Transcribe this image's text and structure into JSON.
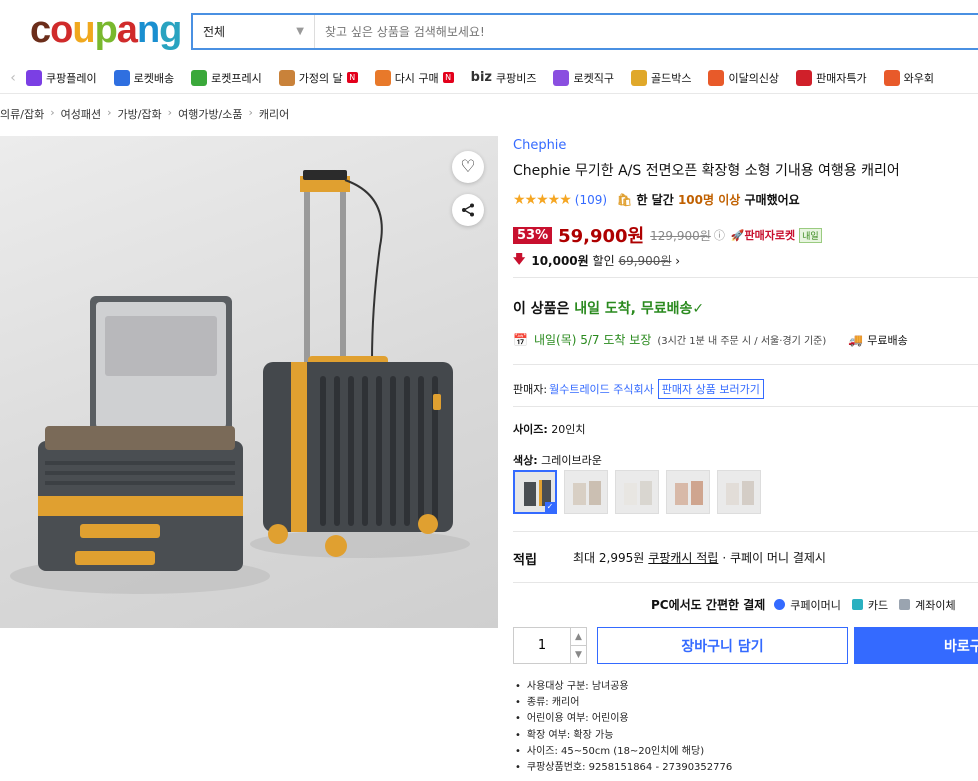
{
  "header": {
    "logo_letters": [
      "c",
      "o",
      "u",
      "p",
      "a",
      "n",
      "g"
    ],
    "logo_colors": [
      "#6b2d1a",
      "#d02b2b",
      "#f0a81e",
      "#79b82e",
      "#d02b2b",
      "#1a8fd0",
      "#29a3c0"
    ],
    "category": "전체",
    "search_placeholder": "찾고 싶은 상품을 검색해보세요!"
  },
  "nav": {
    "items": [
      {
        "label": "쿠팡플레이",
        "icon": "play-icon",
        "color": "#7b3fe4",
        "badge": ""
      },
      {
        "label": "로켓배송",
        "icon": "rocket-icon",
        "color": "#2f6fe0",
        "badge": ""
      },
      {
        "label": "로켓프레시",
        "icon": "rocket-fresh-icon",
        "color": "#3aa83a",
        "badge": ""
      },
      {
        "label": "가정의 달",
        "icon": "bear-icon",
        "color": "#c9823a",
        "badge": "N"
      },
      {
        "label": "다시 구매",
        "icon": "bag-icon",
        "color": "#e8792a",
        "badge": "N"
      },
      {
        "label": "쿠팡비즈",
        "icon": "biz-icon",
        "color": "#333333",
        "badge": "",
        "prefix": "biz"
      },
      {
        "label": "로켓직구",
        "icon": "globe-icon",
        "color": "#8a4fe0",
        "badge": ""
      },
      {
        "label": "골드박스",
        "icon": "giftbox-icon",
        "color": "#e0a82a",
        "badge": ""
      },
      {
        "label": "이달의신상",
        "icon": "new-icon",
        "color": "#e85a2a",
        "badge": ""
      },
      {
        "label": "판매자특가",
        "icon": "percent-icon",
        "color": "#d0202a",
        "badge": ""
      },
      {
        "label": "와우회",
        "icon": "wow-icon",
        "color": "#e85a2a",
        "badge": ""
      }
    ]
  },
  "breadcrumb": [
    "의류/잡화",
    "여성패션",
    "가방/잡화",
    "여행가방/소품",
    "캐리어"
  ],
  "product": {
    "brand": "Chephie",
    "title": "Chephie 무기한 A/S 전면오픈 확장형 소형 기내용 여행용 캐리어",
    "rating_stars": "★★★★★",
    "review_count": "(109)",
    "purchase_pre": "한 달간 ",
    "purchase_hl": "100명 이상",
    "purchase_post": " 구매했어요",
    "discount": "53%",
    "price": "59,900원",
    "original_price": "129,900원",
    "rocket_label": "🚀판매자로켓",
    "rocket_badge": "내일",
    "coupon_amount": "10,000원",
    "coupon_label": "할인",
    "coupon_price": "69,900원",
    "free_pre": "이 상품은 ",
    "free_hl": "내일 도착, 무료배송",
    "delivery_hl": "내일(목) 5/7 도착 보장",
    "delivery_note": "(3시간 1분 내 주문 시 / 서울·경기 기준)",
    "delivery_free": "무료배송",
    "seller_label": "판매자:",
    "seller_name": "월수트레이드 주식회사",
    "seller_button": "판매자 상품 보러가기",
    "size_label": "사이즈:",
    "size_value": "20인치",
    "color_label": "색상:",
    "color_value": "그레이브라운",
    "reward_label": "적립",
    "reward_pre": "최대 2,995원",
    "reward_link": "쿠팡캐시 적립",
    "reward_post": "· 쿠페이 머니 결제시",
    "pay_title": "PC에서도 간편한 결제",
    "pay_methods": [
      "쿠페이머니",
      "카드",
      "계좌이체"
    ],
    "quantity": "1",
    "cart_button": "장바구니 담기",
    "buy_button": "바로구",
    "specs": [
      "사용대상 구분: 남녀공용",
      "종류: 캐리어",
      "어린이용 여부: 어린이용",
      "확장 여부: 확장 가능",
      "사이즈: 45~50cm (18~20인치에 해당)",
      "쿠팡상품번호: 9258151864 - 27390352776"
    ]
  }
}
